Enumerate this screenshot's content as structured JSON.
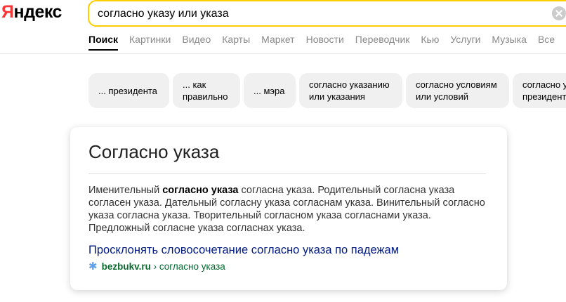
{
  "logo": {
    "first_letter": "Я",
    "rest": "ндекс"
  },
  "search": {
    "query": "согласно указу или указа"
  },
  "tabs": [
    {
      "label": "Поиск"
    },
    {
      "label": "Картинки"
    },
    {
      "label": "Видео"
    },
    {
      "label": "Карты"
    },
    {
      "label": "Маркет"
    },
    {
      "label": "Новости"
    },
    {
      "label": "Переводчик"
    },
    {
      "label": "Кью"
    },
    {
      "label": "Услуги"
    },
    {
      "label": "Музыка"
    },
    {
      "label": "Все"
    }
  ],
  "suggestions": [
    {
      "line1": "... президента",
      "line2": ""
    },
    {
      "line1": "... как",
      "line2": "правильно"
    },
    {
      "line1": "... мэра",
      "line2": ""
    },
    {
      "line1": "согласно указанию",
      "line2": "или указания"
    },
    {
      "line1": "согласно условиям",
      "line2": "или условий"
    },
    {
      "line1": "согласно указу",
      "line2": "президента"
    }
  ],
  "card": {
    "title": "Согласно указа",
    "text_prefix": "Именительный ",
    "text_bold": "согласно указа",
    "text_rest": " согласна указа. Родительный согласна указа согласен указа. Дательный согласну указа согласнам указа. Винительный согласно указа согласна указа. Творительный согласном указа согласнами указа. Предложный согласне указа согласнах указа.",
    "link_text": "Просклонять словосочетание согласно указа по падежам",
    "source_domain": "bezbukv.ru",
    "source_sep": "›",
    "source_path": "согласно указа"
  },
  "colors": {
    "search_border": "#ffcc00",
    "logo_red": "#ff3333",
    "link": "#001a80",
    "source_green": "#0b6b2e"
  },
  "icons": {
    "clear": "clear-icon",
    "source": "snowflake-icon"
  }
}
